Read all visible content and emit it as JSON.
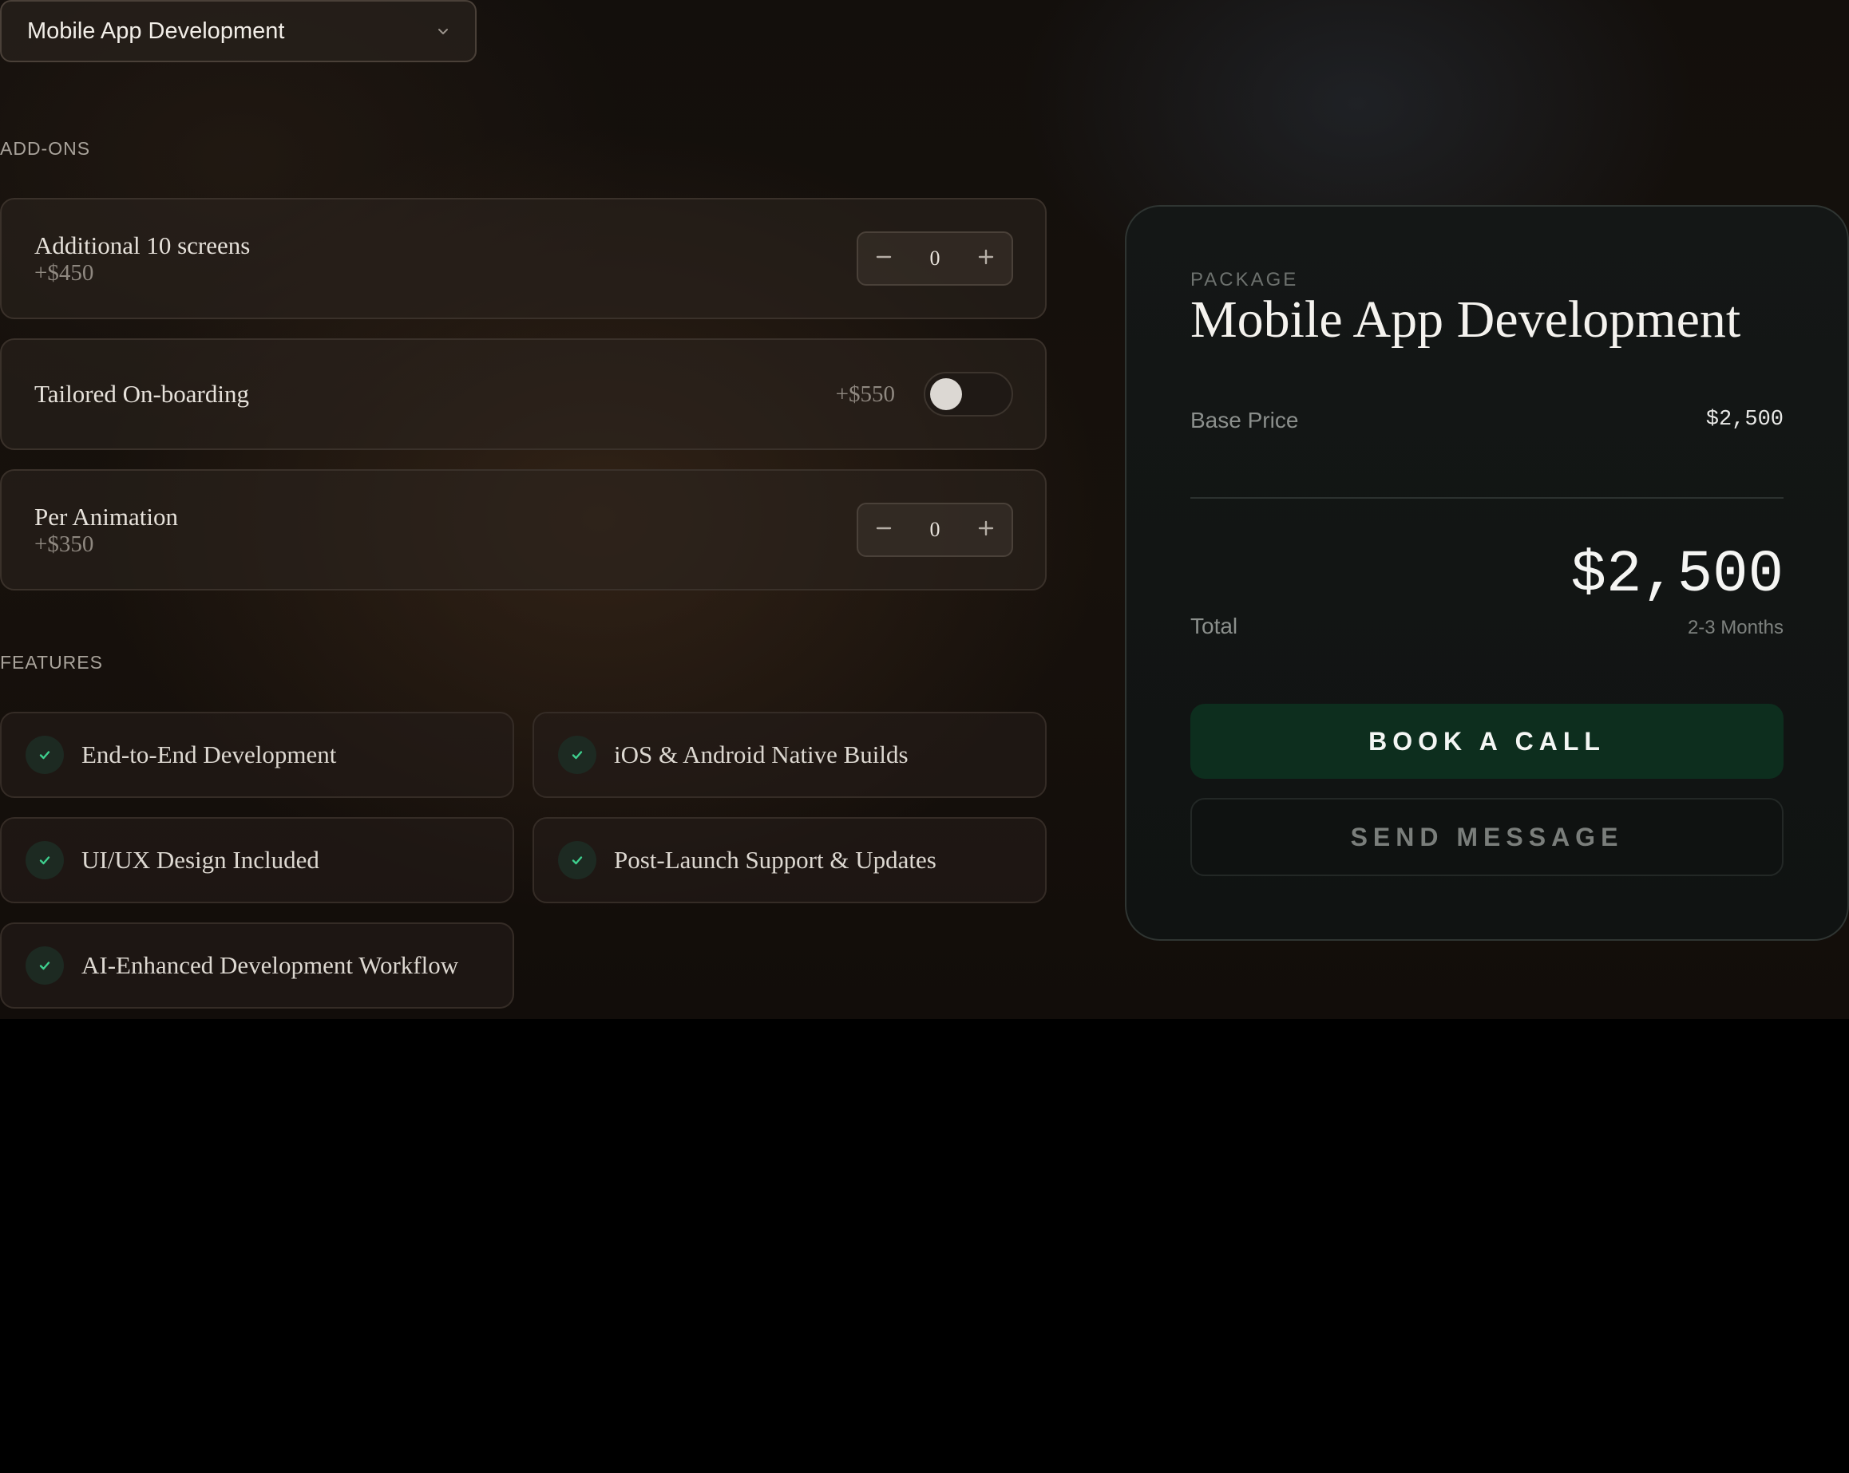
{
  "service_select": {
    "value": "Mobile App Development",
    "icon": "chevron-down-icon"
  },
  "addons": {
    "heading": "ADD-ONS",
    "items": [
      {
        "name": "Additional 10 screens",
        "price": "+$450",
        "control": "stepper",
        "quantity": "0"
      },
      {
        "name": "Tailored On-boarding",
        "price": "+$550",
        "control": "toggle",
        "enabled": false
      },
      {
        "name": "Per Animation",
        "price": "+$350",
        "control": "stepper",
        "quantity": "0"
      }
    ]
  },
  "features": {
    "heading": "FEATURES",
    "items": [
      "End-to-End Development",
      "iOS & Android Native Builds",
      "UI/UX Design Included",
      "Post-Launch Support & Updates",
      "AI-Enhanced Development Workflow"
    ]
  },
  "package": {
    "kicker": "PACKAGE",
    "title": "Mobile App Development",
    "base_price_label": "Base Price",
    "base_price": "$2,500",
    "total_label": "Total",
    "total": "$2,500",
    "duration": "2-3 Months",
    "primary_button": "BOOK A CALL",
    "secondary_button": "SEND MESSAGE"
  },
  "colors": {
    "accent_green": "#0d2e1e",
    "check_green": "#3ecf8e",
    "background": "#17110c"
  }
}
